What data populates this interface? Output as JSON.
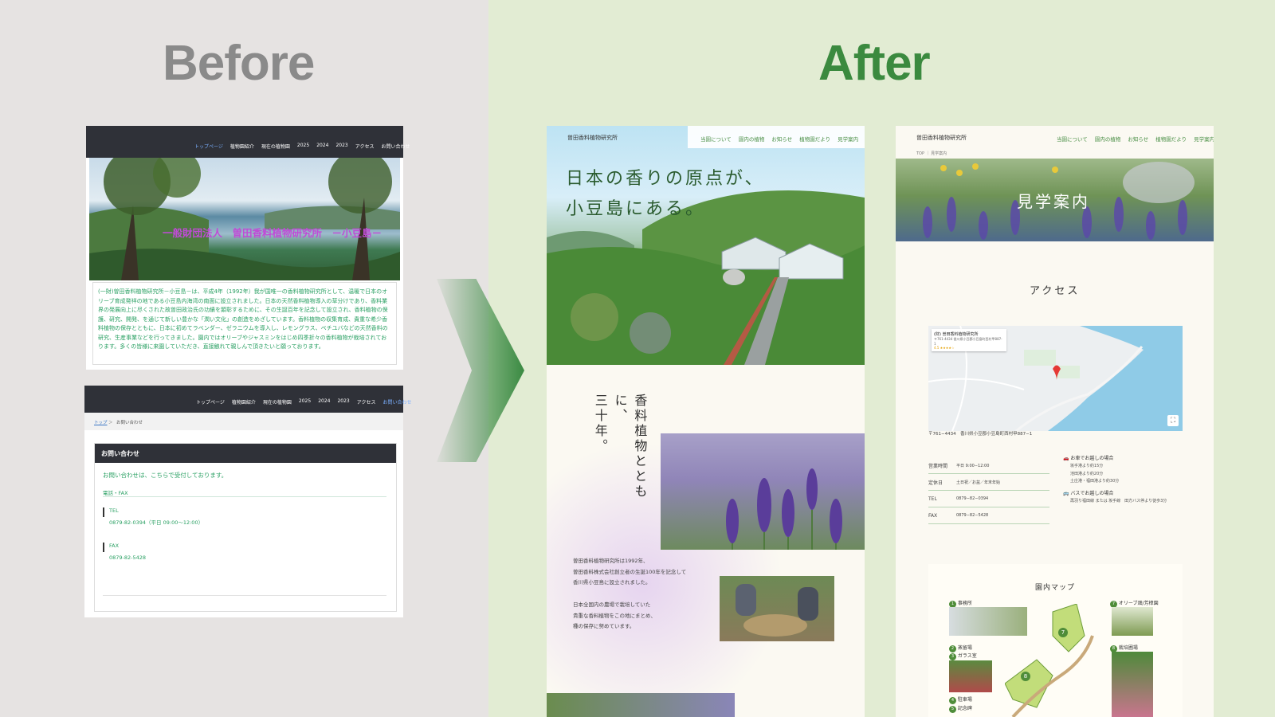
{
  "labels": {
    "before": "Before",
    "after": "After"
  },
  "colors": {
    "before_heading": "#8a8a8a",
    "after_heading": "#3b8a3f",
    "accent": "#3b8a3f"
  },
  "old_home": {
    "nav": [
      "トップページ",
      "植物園紹介",
      "現在の植物園",
      "2025",
      "2024",
      "2023",
      "アクセス",
      "お問い合わせ"
    ],
    "hero_title": "一般財団法人　曽田香料植物研究所　－小豆島－",
    "intro": "(一財)曽田香料植物研究所－小豆島－は、平成4年（1992年）我が国唯一の香料植物研究所として、温暖で日本のオリーブ育成発祥の地である小豆島内海湾の南面に設立されました。日本の天然香料植物導入の草分けであり、香料業界の発展向上に尽くされた故曽田政治氏の功績を顕彰するために、その生誕百年を記念して設立され、香料植物の保護、研究、開発、を通じて新しい豊かな「潤い文化」の創造をめざしています。香料植物の収集育成、貴重な希少香料植物の保存とともに、日本に初めてラベンダー、ゼラニウムを導入し、レモングラス、ベチユバなどの天然香料の研究、生産事業などを行ってきました。園内ではオリーブやジャスミンをはじめ四季折々の香料植物が栽培されております。多くの皆様に来園していただき、直接触れて親しんで頂きたいと願っております。"
  },
  "old_contact": {
    "nav": [
      "トップページ",
      "植物園紹介",
      "現在の植物園",
      "2025",
      "2024",
      "2023",
      "アクセス",
      "お問い合わせ"
    ],
    "breadcrumb_home": "トップ",
    "breadcrumb_sep": "＞",
    "breadcrumb_current": "お問い合わせ",
    "heading": "お問い合わせ",
    "lead": "お問い合わせは、こちらで受付しております。",
    "section": "電話・FAX",
    "tel_label": "TEL",
    "tel_value": "0879-82-0394（平日 09:00～12:00）",
    "fax_label": "FAX",
    "fax_value": "0879-82-5428"
  },
  "new_home": {
    "logo": "曽田香料植物研究所",
    "nav": [
      "当園について",
      "園内の植物",
      "お知らせ",
      "植物園だより",
      "見学案内"
    ],
    "hero_line1": "日本の香りの原点が、",
    "hero_line2": "小豆島にある。",
    "vertical_1": "香料植物とともに、",
    "vertical_2": "三十年。",
    "body_1": "曽田香料植物研究所は1992年、",
    "body_2": "曽田香料株式会社創立者の生誕100年を記念して",
    "body_3": "香川県小豆島に設立されました。",
    "body_4": "日本全国内の農場で栽培していた",
    "body_5": "貴重な香料植物をこの地にまとめ、",
    "body_6": "種の保存に努めています。"
  },
  "new_access": {
    "logo": "曽田香料植物研究所",
    "nav": [
      "当園について",
      "園内の植物",
      "お知らせ",
      "植物園だより",
      "見学案内"
    ],
    "breadcrumb": "TOP ｜ 見学案内",
    "page_title": "見学案内",
    "access_heading": "アクセス",
    "map_card_title": "(財) 曽田香料植物研究所",
    "map_card_addr": "〒761-4434 香川県小豆郡小豆島町西村甲887-1",
    "map_card_rating": "4.5 ★★★★☆",
    "address": "〒761−4434　香川県小豆郡小豆島町西村甲887−1",
    "info": [
      {
        "label": "営業時間",
        "value": "平日 9:00−12:00"
      },
      {
        "label": "定休日",
        "value": "土日祝／お盆／年末年始"
      },
      {
        "label": "TEL",
        "value": "0879−82−0394"
      },
      {
        "label": "FAX",
        "value": "0879−82−5428"
      }
    ],
    "car_title": "お車でお越しの場合",
    "car_lines": [
      "坂手港より約15分",
      "池田港より約20分",
      "土庄港・福田港より約30分"
    ],
    "bus_title": "バスでお越しの場合",
    "bus_lines": [
      "再羽り福田線 または 坂手線　田方バス停より徒歩3分"
    ],
    "map_heading": "園内マップ",
    "map_items": [
      {
        "num": "1",
        "label": "事務所"
      },
      {
        "num": "2",
        "label": "蒸留場"
      },
      {
        "num": "3",
        "label": "ガラス室"
      },
      {
        "num": "4",
        "label": "駐車場"
      },
      {
        "num": "5",
        "label": "記念碑"
      },
      {
        "num": "7",
        "label": "オリーブ畑/芳樟園"
      },
      {
        "num": "8",
        "label": "栽培圃場"
      }
    ]
  }
}
